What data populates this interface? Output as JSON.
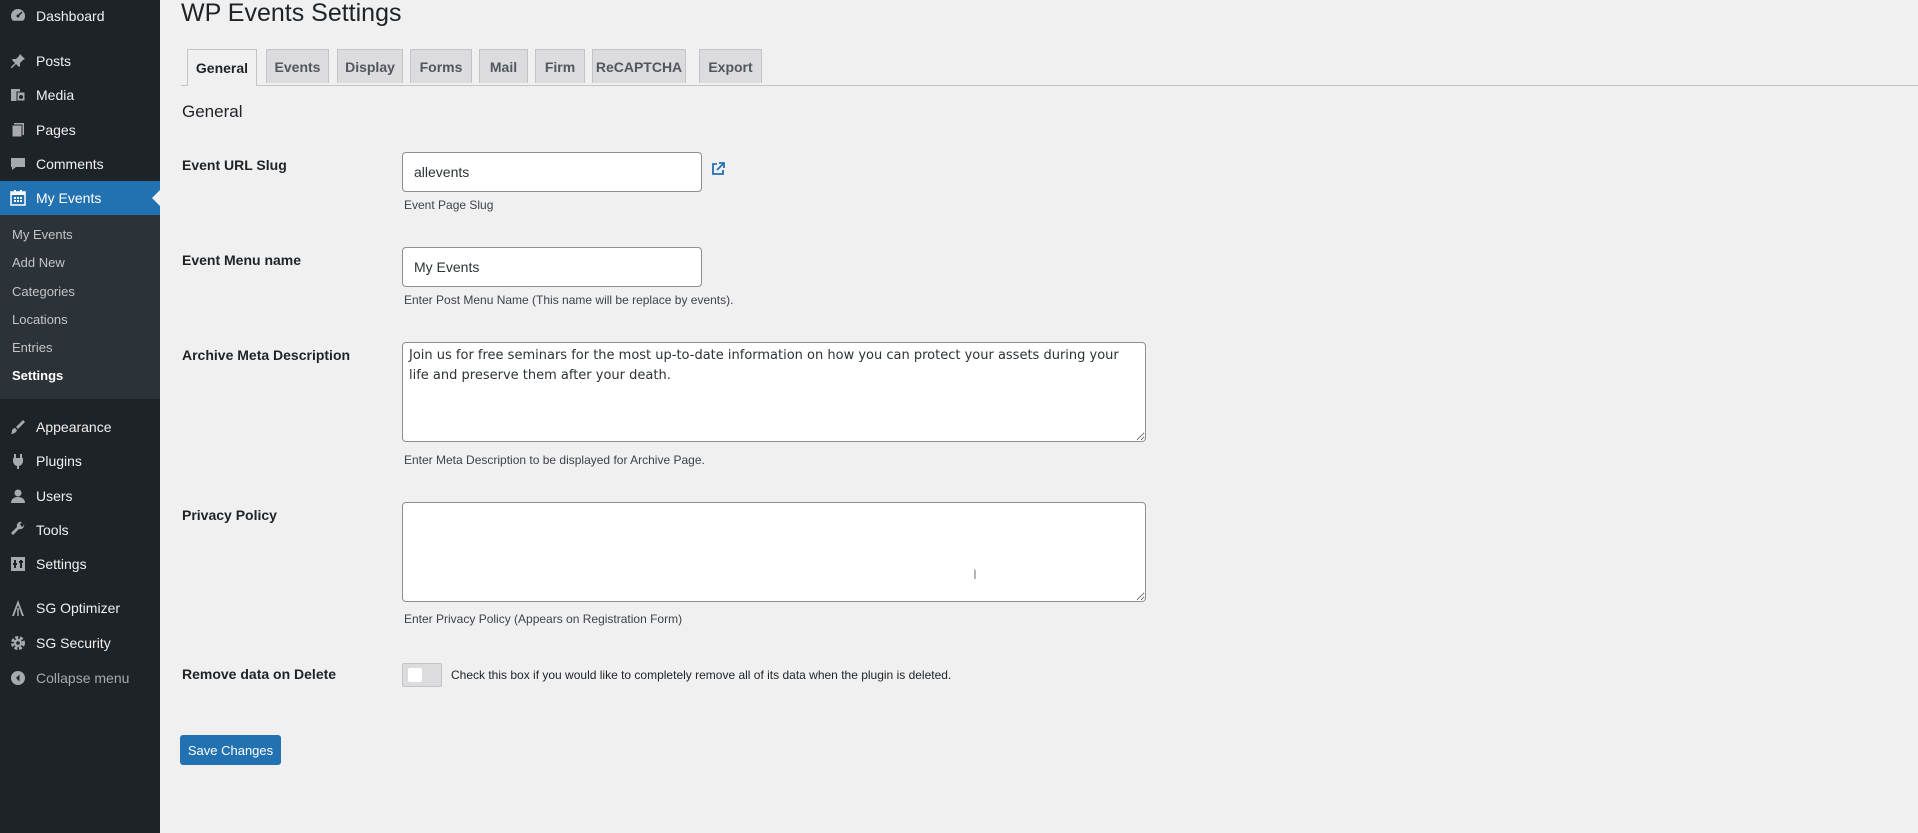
{
  "sidebar": {
    "items": [
      {
        "label": "Dashboard",
        "icon": "dashboard-icon"
      },
      {
        "label": "Posts",
        "icon": "pin-icon"
      },
      {
        "label": "Media",
        "icon": "media-icon"
      },
      {
        "label": "Pages",
        "icon": "pages-icon"
      },
      {
        "label": "Comments",
        "icon": "comment-icon"
      },
      {
        "label": "My Events",
        "icon": "calendar-icon"
      },
      {
        "label": "Appearance",
        "icon": "brush-icon"
      },
      {
        "label": "Plugins",
        "icon": "plug-icon"
      },
      {
        "label": "Users",
        "icon": "user-icon"
      },
      {
        "label": "Tools",
        "icon": "wrench-icon"
      },
      {
        "label": "Settings",
        "icon": "settings-icon"
      },
      {
        "label": "SG Optimizer",
        "icon": "sg-optimizer-icon"
      },
      {
        "label": "SG Security",
        "icon": "gear-icon"
      },
      {
        "label": "Collapse menu",
        "icon": "collapse-icon"
      }
    ],
    "submenu": [
      "My Events",
      "Add New",
      "Categories",
      "Locations",
      "Entries",
      "Settings"
    ]
  },
  "page": {
    "title": "WP Events Settings",
    "tabs": [
      "General",
      "Events",
      "Display",
      "Forms",
      "Mail",
      "Firm",
      "ReCAPTCHA",
      "Export"
    ],
    "section_title": "General"
  },
  "form": {
    "slug_label": "Event URL Slug",
    "slug_value": "allevents",
    "slug_desc": "Event Page Slug",
    "menu_label": "Event Menu name",
    "menu_value": "My Events",
    "menu_desc": "Enter Post Menu Name (This name will be replace by events).",
    "meta_label": "Archive Meta Description",
    "meta_value": "Join us for free seminars for the most up-to-date information on how you can protect your assets during your life and preserve them after your death.",
    "meta_desc": "Enter Meta Description to be displayed for Archive Page.",
    "privacy_label": "Privacy Policy",
    "privacy_value": "",
    "privacy_desc": "Enter Privacy Policy (Appears on Registration Form)",
    "remove_label": "Remove data on Delete",
    "remove_desc": "Check this box if you would like to completely remove all of its data when the plugin is deleted.",
    "remove_checked": false,
    "save_label": "Save Changes"
  },
  "colors": {
    "sidebar_bg": "#1d2327",
    "accent": "#2271b1",
    "page_bg": "#f0f0f1"
  }
}
